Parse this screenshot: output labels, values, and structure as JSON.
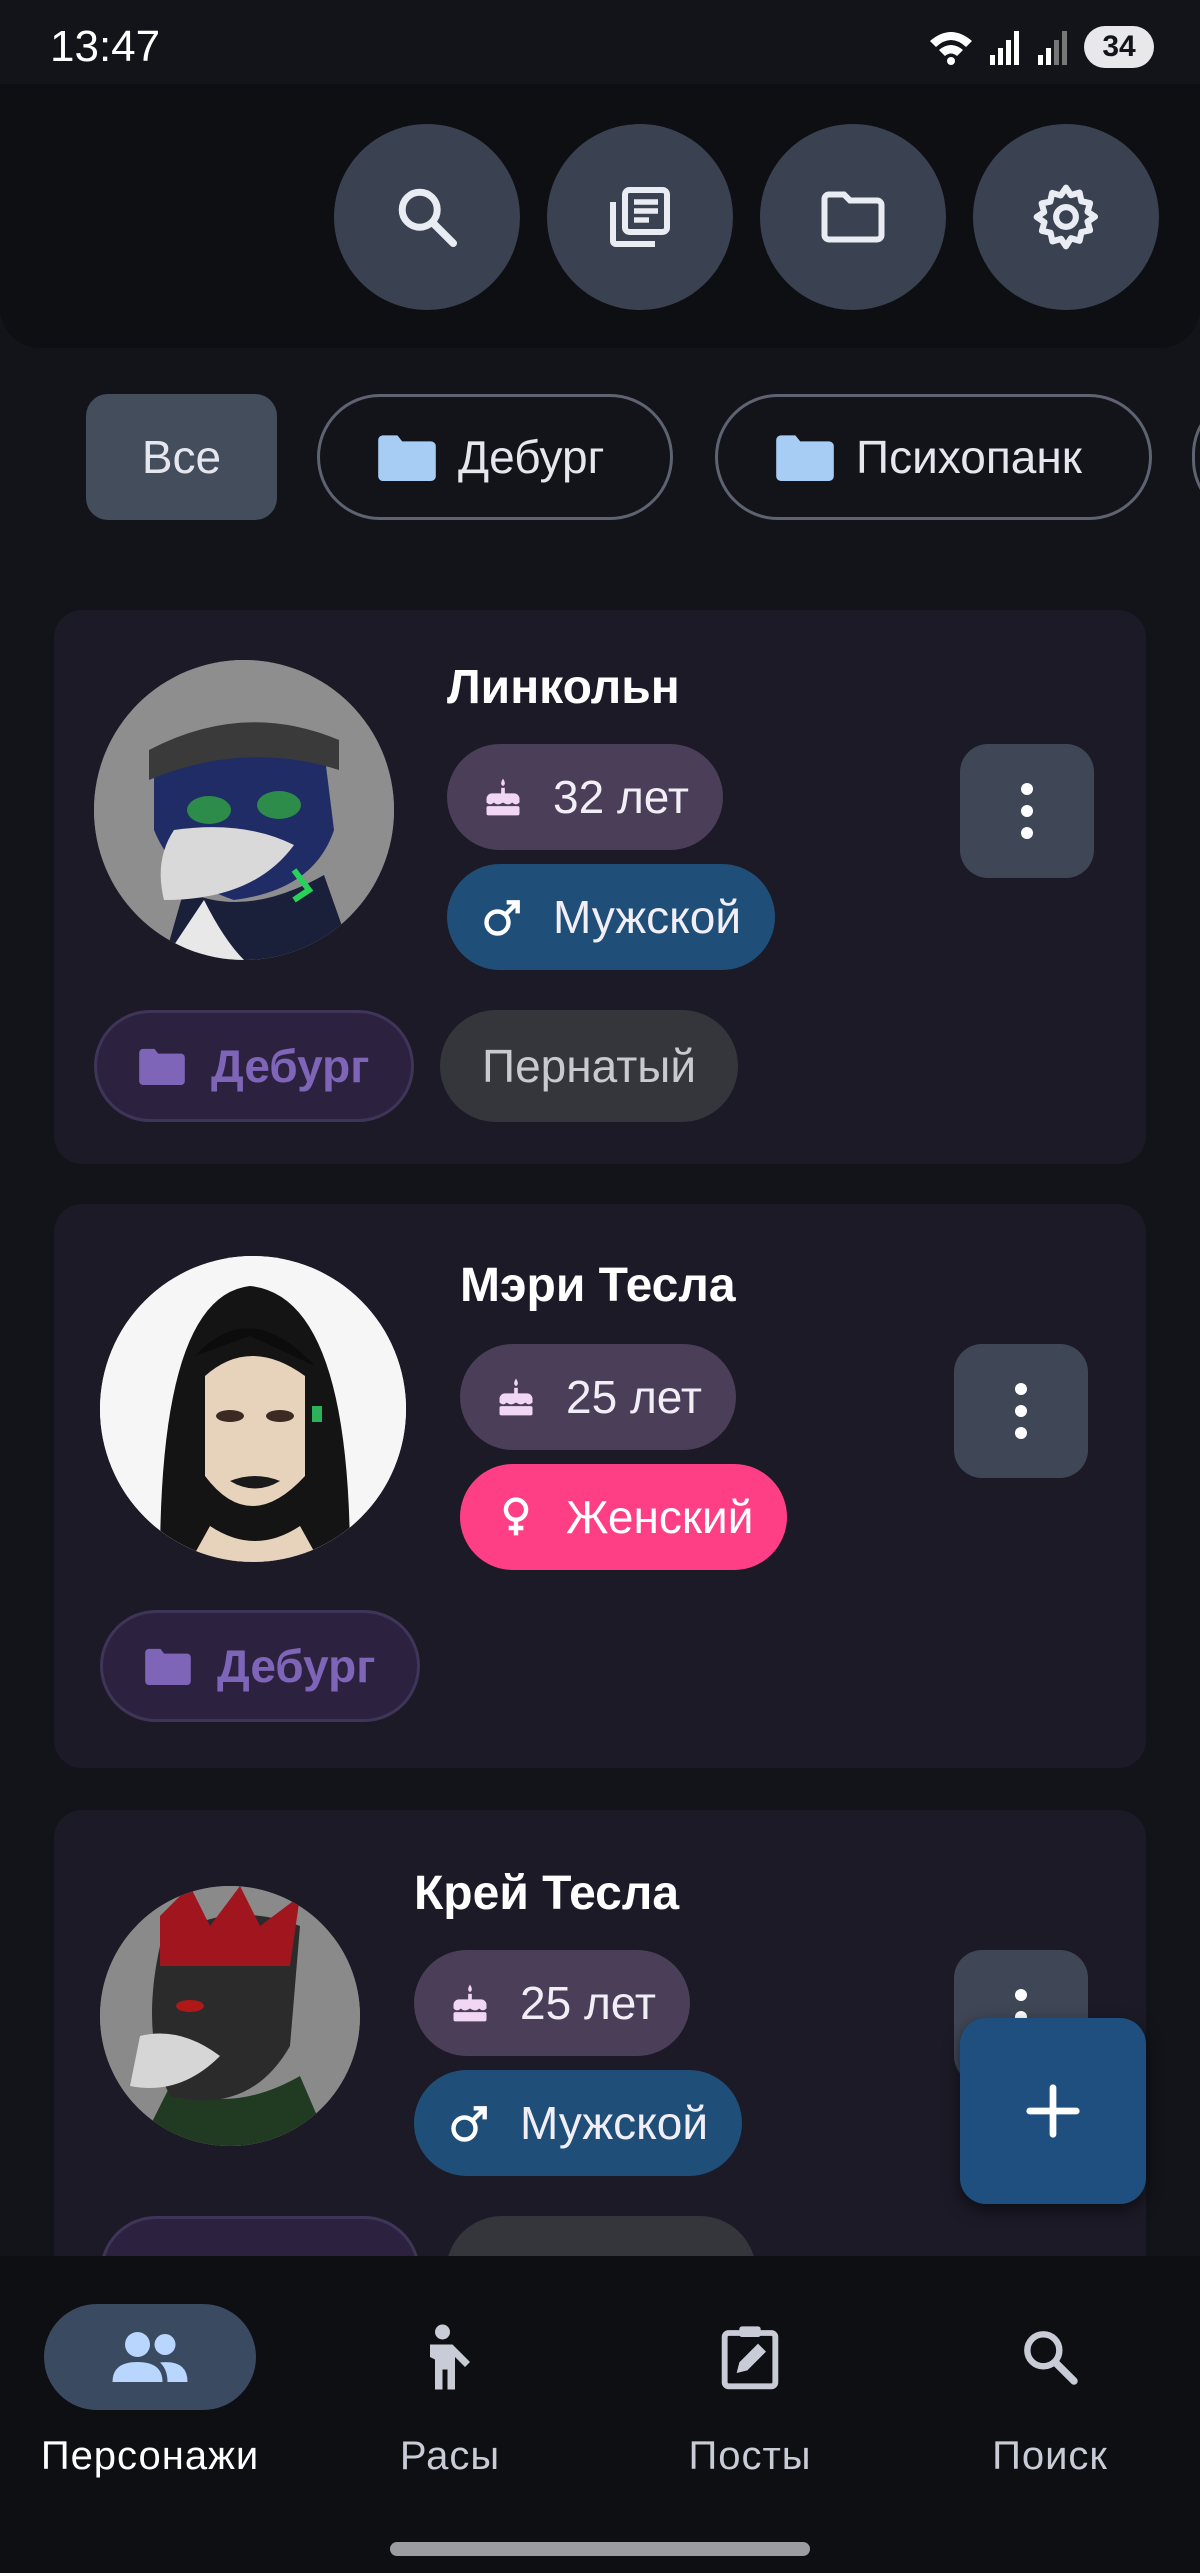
{
  "status": {
    "time": "13:47",
    "battery": "34"
  },
  "toolbar": {
    "buttons": [
      {
        "icon": "search-icon"
      },
      {
        "icon": "library-icon"
      },
      {
        "icon": "folder-icon"
      },
      {
        "icon": "settings-icon"
      }
    ]
  },
  "filters": {
    "all_label": "Все",
    "folders": [
      "Дебург",
      "Психопанк"
    ]
  },
  "characters": [
    {
      "name": "Линкольн",
      "age": "32 лет",
      "gender": "Мужской",
      "gender_type": "male",
      "folder": "Дебург",
      "race": "Пернатый"
    },
    {
      "name": "Мэри Тесла",
      "age": "25 лет",
      "gender": "Женский",
      "gender_type": "female",
      "folder": "Дебург",
      "race": ""
    },
    {
      "name": "Крей Тесла",
      "age": "25 лет",
      "gender": "Мужской",
      "gender_type": "male",
      "folder": "",
      "race": ""
    }
  ],
  "fab": {
    "icon": "plus-icon"
  },
  "nav": {
    "items": [
      {
        "label": "Персонажи",
        "icon": "people-icon",
        "active": true
      },
      {
        "label": "Расы",
        "icon": "figure-icon",
        "active": false
      },
      {
        "label": "Посты",
        "icon": "edit-post-icon",
        "active": false
      },
      {
        "label": "Поиск",
        "icon": "search-icon",
        "active": false
      }
    ]
  },
  "colors": {
    "background": "#12141a",
    "card": "#1c1a26",
    "male": "#1f4f78",
    "female": "#ff3f85",
    "folder_tag": "#7f65b8",
    "chip_folder_icon": "#a8cdf5"
  }
}
